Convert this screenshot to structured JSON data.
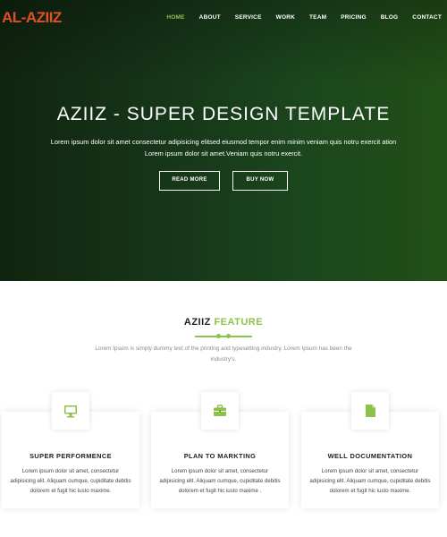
{
  "header": {
    "logo": "AL-AZIIZ",
    "nav": [
      "HOME",
      "ABOUT",
      "SERVICE",
      "WORK",
      "TEAM",
      "PRICING",
      "BLOG",
      "CONTACT"
    ],
    "active_nav": "HOME"
  },
  "hero": {
    "title": "AZIIZ - SUPER DESIGN TEMPLATE",
    "subtitle": "Lorem ipsum dolor sit amet consectetur adipisicing elitsed eiusmod tempor enim minim veniam quis notru exercit ation Lorem ipsum dolor sit amet.Veniam quis notru exercit.",
    "read_more": "READ MORE",
    "buy_now": "BUY NOW"
  },
  "features": {
    "title_main": "AZIIZ",
    "title_accent": "FEATURE",
    "description": "Lorem Ipsum is simply dummy text of the printing and typesetting industry. Lorem Ipsum has been the industry's.",
    "cards": [
      {
        "icon": "monitor-icon",
        "title": "SUPER PERFORMENCE",
        "text": "Lorem ipsum dolor sit amet, consectetur adipisicing elit. Aliquam cumque, cupiditate debitis dolorem et fugit hic iusto maxime."
      },
      {
        "icon": "briefcase-icon",
        "title": "PLAN TO MARKTING",
        "text": "Lorem ipsum dolor sit amet, consectetur adipisicing elit. Aliquam cumque, cupiditate debitis dolorem et fugit hic iusto maxime ."
      },
      {
        "icon": "document-icon",
        "title": "WELL DOCUMENTATION",
        "text": "Lorem ipsum dolor sit amet, consectetur adipisicing elit. Aliquam cumque, cupiditate debitis dolorem et fugit hic iusto maxime."
      }
    ]
  },
  "colors": {
    "accent": "#8bc34a",
    "logo": "#e0502a",
    "hero_dark": "#10250f",
    "hero_light": "#234f18"
  }
}
